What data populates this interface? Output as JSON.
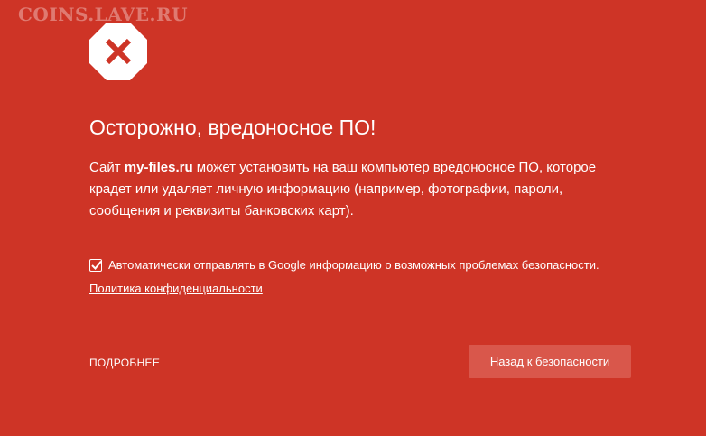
{
  "watermark": "COINS.LAVE.RU",
  "icon": {
    "name": "malware-stop-icon",
    "color": "#ce3426"
  },
  "heading": "Осторожно, вредоносное ПО!",
  "description": {
    "prefix": "Сайт ",
    "site": "my-files.ru",
    "suffix": " может установить на ваш компьютер вредоносное ПО, которое крадет или удаляет личную информацию (например, фотографии, пароли, сообщения и реквизиты банковских карт)."
  },
  "report": {
    "checked": true,
    "label": "Автоматически отправлять в Google информацию о возможных проблемах безопасности."
  },
  "privacy_link": "Политика конфиденциальности",
  "details_button": "ПОДРОБНЕЕ",
  "back_button": "Назад к безопасности",
  "colors": {
    "background": "#ce3426",
    "button": "#d9574b",
    "text": "#ffffff"
  }
}
